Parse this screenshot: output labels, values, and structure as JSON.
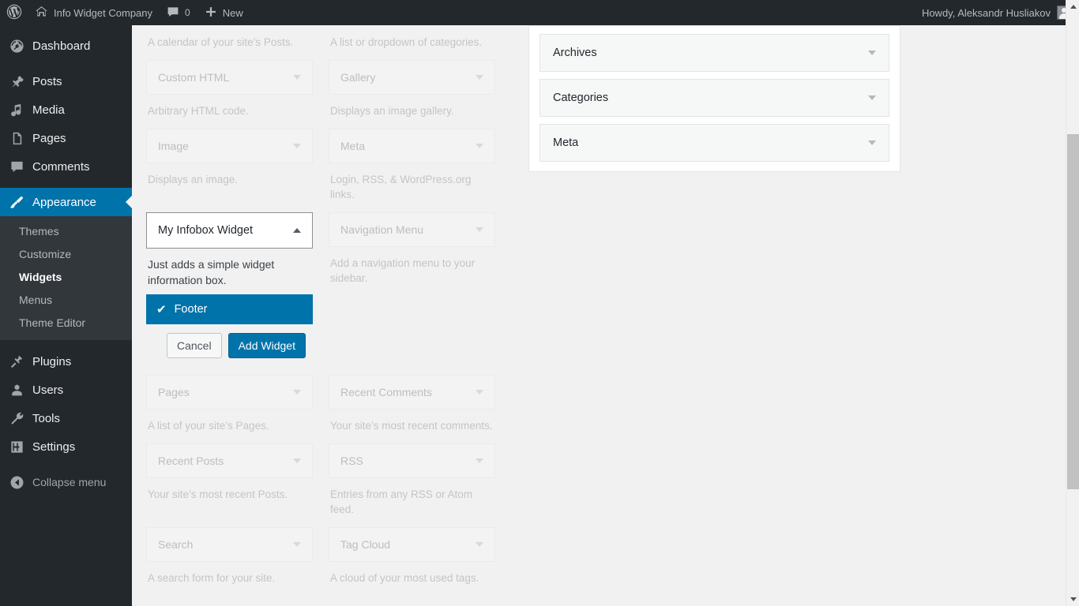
{
  "adminbar": {
    "wp_logo": "wordpress-logo",
    "site_name": "Info Widget Company",
    "comments_count": "0",
    "new_label": "New",
    "greeting": "Howdy, Aleksandr Husliakov"
  },
  "sidebar": {
    "items": [
      {
        "label": "Dashboard",
        "icon": "dashboard-icon",
        "active": false
      },
      {
        "label": "Posts",
        "icon": "pin-icon",
        "active": false
      },
      {
        "label": "Media",
        "icon": "media-icon",
        "active": false
      },
      {
        "label": "Pages",
        "icon": "pages-icon",
        "active": false
      },
      {
        "label": "Comments",
        "icon": "comment-icon",
        "active": false
      },
      {
        "label": "Appearance",
        "icon": "paintbrush-icon",
        "active": true
      },
      {
        "label": "Plugins",
        "icon": "plugin-icon",
        "active": false
      },
      {
        "label": "Users",
        "icon": "user-icon",
        "active": false
      },
      {
        "label": "Tools",
        "icon": "wrench-icon",
        "active": false
      },
      {
        "label": "Settings",
        "icon": "settings-icon",
        "active": false
      }
    ],
    "submenu": [
      {
        "label": "Themes",
        "current": false
      },
      {
        "label": "Customize",
        "current": false
      },
      {
        "label": "Widgets",
        "current": true
      },
      {
        "label": "Menus",
        "current": false
      },
      {
        "label": "Theme Editor",
        "current": false
      }
    ],
    "collapse_label": "Collapse menu"
  },
  "available_widgets": {
    "top_descriptions": {
      "left": "A calendar of your site’s Posts.",
      "right": "A list or dropdown of categories."
    },
    "rows": [
      {
        "left": {
          "title": "Custom HTML",
          "desc": "Arbitrary HTML code."
        },
        "right": {
          "title": "Gallery",
          "desc": "Displays an image gallery."
        }
      },
      {
        "left": {
          "title": "Image",
          "desc": "Displays an image."
        },
        "right": {
          "title": "Meta",
          "desc": "Login, RSS, & WordPress.org links."
        }
      }
    ],
    "active_widget": {
      "title": "My Infobox Widget",
      "desc": "Just adds a simple widget information box.",
      "sidebar_option": "Footer",
      "checkmark": "✔",
      "cancel_label": "Cancel",
      "add_label": "Add Widget"
    },
    "nav_menu": {
      "title": "Navigation Menu",
      "desc": "Add a navigation menu to your sidebar."
    },
    "rows_after": [
      {
        "left": {
          "title": "Pages",
          "desc": "A list of your site’s Pages."
        },
        "right": {
          "title": "Recent Comments",
          "desc": "Your site’s most recent comments."
        }
      },
      {
        "left": {
          "title": "Recent Posts",
          "desc": "Your site’s most recent Posts."
        },
        "right": {
          "title": "RSS",
          "desc": "Entries from any RSS or Atom feed."
        }
      },
      {
        "left": {
          "title": "Search",
          "desc": "A search form for your site."
        },
        "right": {
          "title": "Tag Cloud",
          "desc": "A cloud of your most used tags."
        }
      }
    ]
  },
  "sidebars_panel": {
    "boxes": [
      {
        "title": "Archives"
      },
      {
        "title": "Categories"
      },
      {
        "title": "Meta"
      }
    ]
  },
  "colors": {
    "accent": "#0073aa",
    "admin_bg": "#23282d",
    "submenu_bg": "#32373c",
    "page_bg": "#f1f1f1"
  }
}
